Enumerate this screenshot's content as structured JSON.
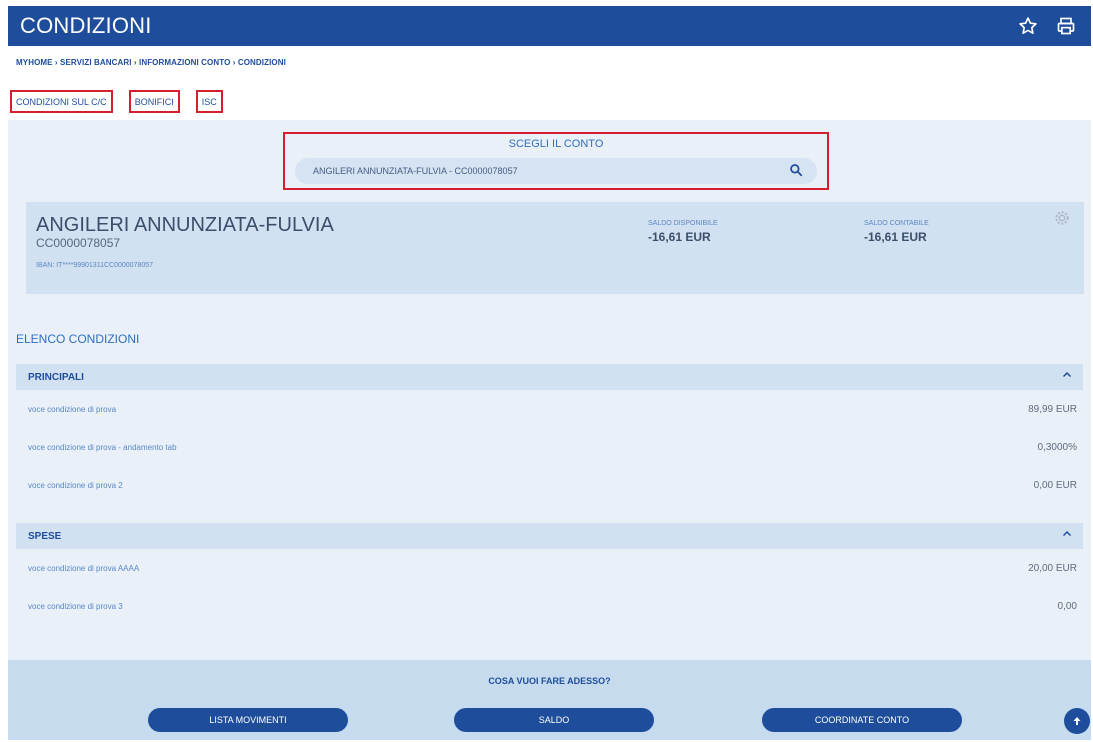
{
  "header": {
    "title": "CONDIZIONI",
    "icons": [
      "star-icon",
      "print-icon"
    ]
  },
  "breadcrumb": "MYHOME › SERVIZI BANCARI › INFORMAZIONI CONTO › CONDIZIONI",
  "tabs": [
    {
      "label": "CONDIZIONI SUL C/C"
    },
    {
      "label": "BONIFICI"
    },
    {
      "label": "ISC"
    }
  ],
  "account_selector": {
    "label": "SCEGLI IL CONTO",
    "value": "ANGILERI ANNUNZIATA-FULVIA - CC0000078057"
  },
  "account_card": {
    "holder": "ANGILERI ANNUNZIATA-FULVIA",
    "account_number": "CC0000078057",
    "iban": "IBAN: IT****99901311CC0000078057",
    "available_label": "SALDO DISPONIBILE",
    "available_value": "-16,61 EUR",
    "book_label": "SALDO CONTABILE",
    "book_value": "-16,61 EUR"
  },
  "conditions": {
    "title": "ELENCO CONDIZIONI",
    "groups": [
      {
        "title": "PRINCIPALI",
        "rows": [
          {
            "label": "voce condizione di prova",
            "value": "89,99 EUR"
          },
          {
            "label": "voce condizione di prova - andamento tab",
            "value": "0,3000%"
          },
          {
            "label": "voce condizione di prova 2",
            "value": "0,00 EUR"
          }
        ]
      },
      {
        "title": "SPESE",
        "rows": [
          {
            "label": "voce condizione di prova AAAA",
            "value": "20,00 EUR"
          },
          {
            "label": "voce condizione di prova 3",
            "value": "0,00"
          }
        ]
      }
    ]
  },
  "footer": {
    "question": "COSA VUOI FARE ADESSO?",
    "buttons": [
      "LISTA MOVIMENTI",
      "SALDO",
      "COORDINATE CONTO"
    ]
  }
}
